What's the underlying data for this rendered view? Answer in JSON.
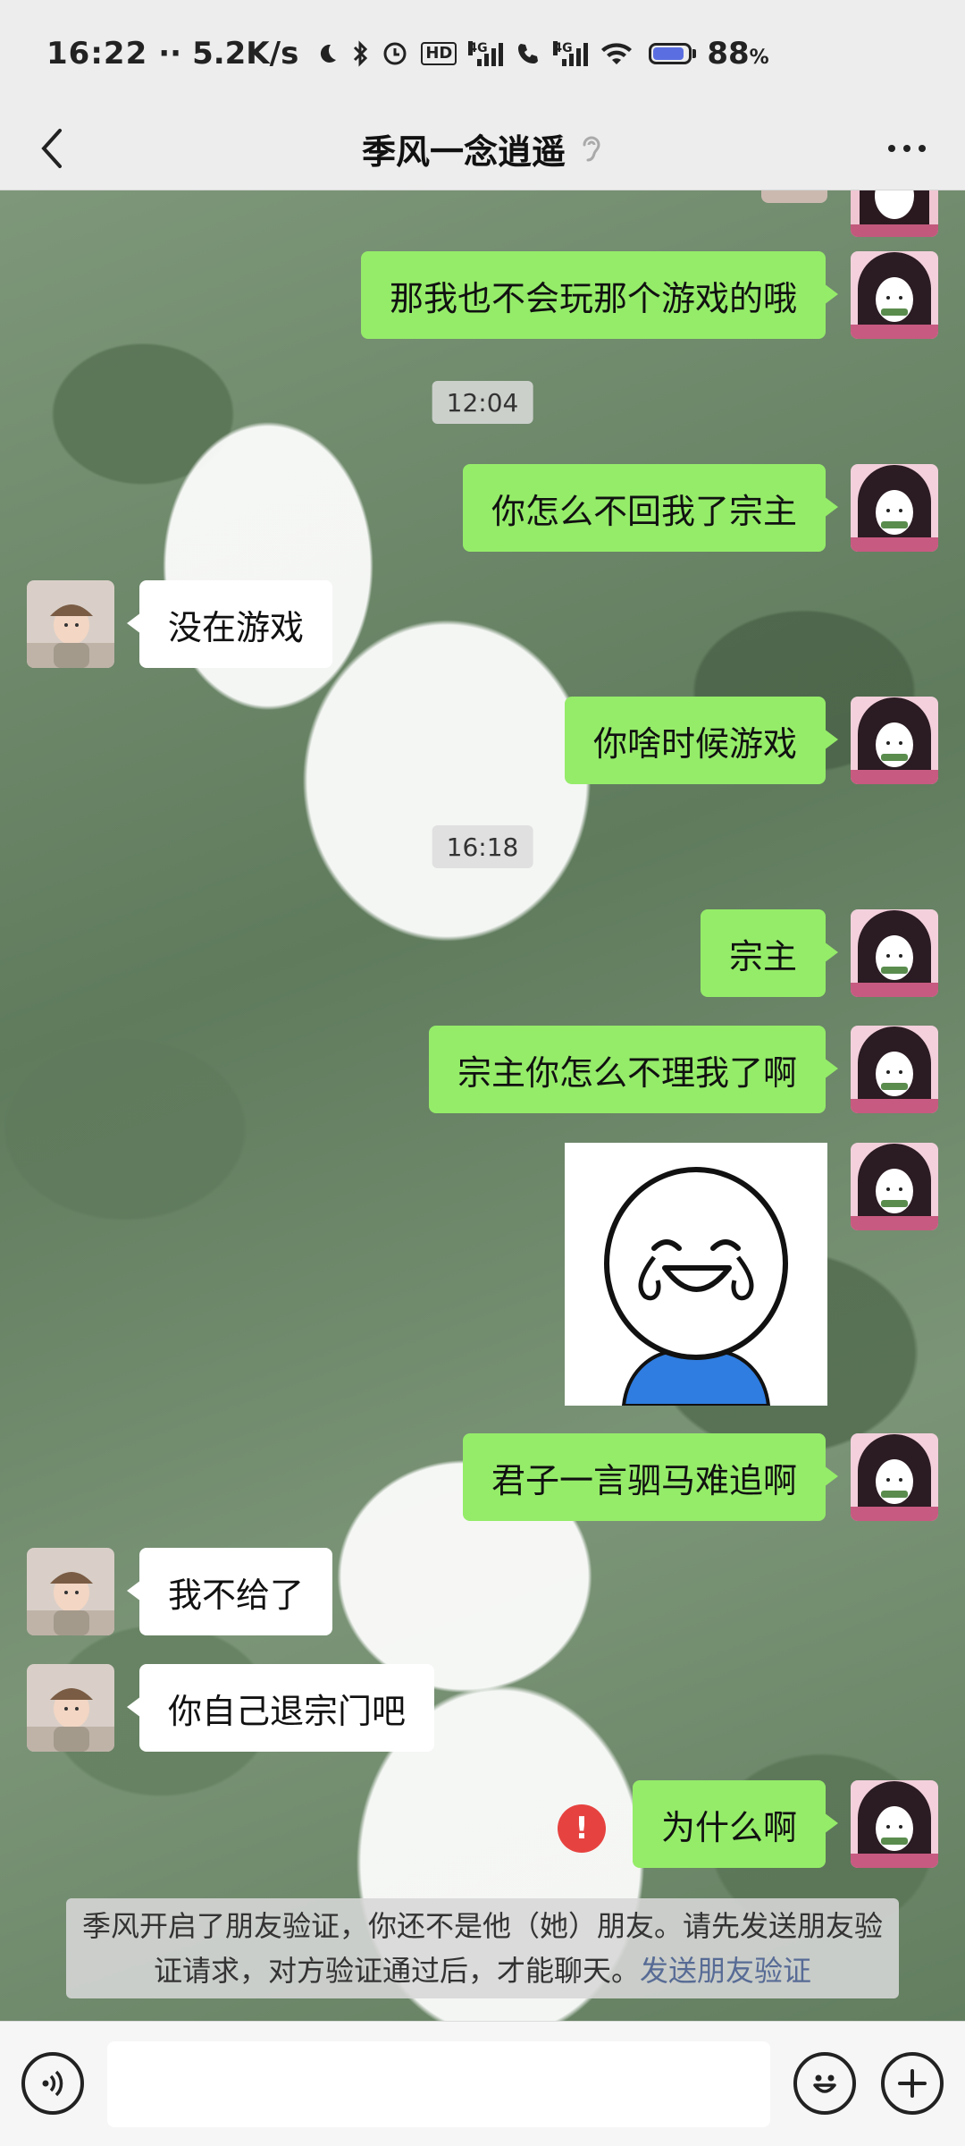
{
  "status_bar": {
    "time": "16:22",
    "dots": "··",
    "net_speed": "5.2K/s",
    "network1": "4G",
    "network2": "4G",
    "hd_badge": "HD",
    "battery_percent": "88",
    "percent_sign": "%"
  },
  "header": {
    "title": "季风一念逍遥"
  },
  "timestamps": [
    "12:04",
    "16:18"
  ],
  "messages": [
    {
      "from": "me",
      "text": "那我也不会玩那个游戏的哦"
    },
    {
      "from": "me",
      "text": "你怎么不回我了宗主"
    },
    {
      "from": "other",
      "text": "没在游戏"
    },
    {
      "from": "me",
      "text": "你啥时候游戏"
    },
    {
      "from": "me",
      "text": "宗主"
    },
    {
      "from": "me",
      "text": "宗主你怎么不理我了啊"
    },
    {
      "from": "me",
      "text": "君子一言驷马难追啊"
    },
    {
      "from": "other",
      "text": "我不给了"
    },
    {
      "from": "other",
      "text": "你自己退宗门吧"
    },
    {
      "from": "me",
      "text": "为什么啊",
      "failed": true
    }
  ],
  "failed_icon": "!",
  "system_notice": {
    "text": "季风开启了朋友验证，你还不是他（她）朋友。请先发送朋友验证请求，对方验证通过后，才能聊天。",
    "link": "发送朋友验证"
  },
  "icons": {
    "back": "back-arrow-icon",
    "more": "more-dots-icon",
    "ear": "ear-icon",
    "voice": "voice-icon",
    "emoji": "emoji-icon",
    "plus": "plus-icon",
    "failed": "exclamation-icon"
  },
  "colors": {
    "my_bubble": "#95ec69",
    "other_bubble": "#ffffff",
    "error": "#e64340",
    "link": "#576b95"
  }
}
